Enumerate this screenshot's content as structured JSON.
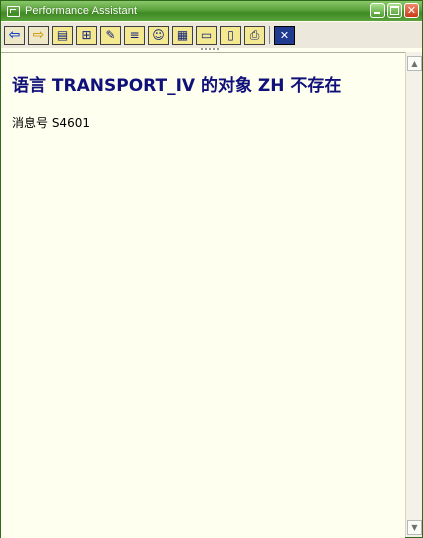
{
  "window": {
    "title": "Performance Assistant"
  },
  "toolbar": {
    "buttons": [
      {
        "name": "back-button",
        "icon": "arrow-left-icon",
        "glyph": "⇦"
      },
      {
        "name": "forward-button",
        "icon": "arrow-right-icon",
        "glyph": "⇨"
      },
      {
        "name": "book-button",
        "icon": "book-icon",
        "glyph": "▤"
      },
      {
        "name": "structure-button",
        "icon": "hierarchy-icon",
        "glyph": "⊞"
      },
      {
        "name": "edit-button",
        "icon": "pencil-icon",
        "glyph": "✎"
      },
      {
        "name": "technical-info-button",
        "icon": "info-lines-icon",
        "glyph": "≡"
      },
      {
        "name": "users-button",
        "icon": "people-icon",
        "glyph": "☺"
      },
      {
        "name": "table-button",
        "icon": "table-icon",
        "glyph": "▦"
      },
      {
        "name": "notes-button",
        "icon": "note-icon",
        "glyph": "▭"
      },
      {
        "name": "settings-button",
        "icon": "dialog-icon",
        "glyph": "▯"
      },
      {
        "name": "print-button",
        "icon": "printer-icon",
        "glyph": "⎙"
      },
      {
        "name": "exit-button",
        "icon": "close-x-icon",
        "glyph": "✕"
      }
    ]
  },
  "message": {
    "title": "语言  TRANSPORT_IV 的对象  ZH 不存在",
    "number_label": "消息号  S4601"
  },
  "colors": {
    "title_bar": "#5aa23c",
    "content_bg": "#fffff0",
    "title_text": "#10107a"
  }
}
